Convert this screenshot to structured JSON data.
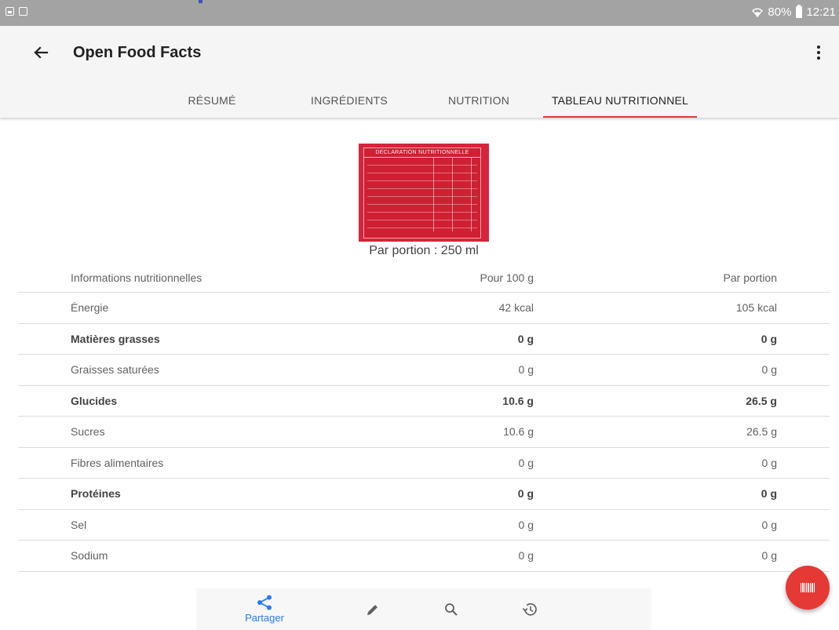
{
  "status_bar": {
    "battery": "80%",
    "time": "12:21",
    "left_icons": [
      "image-icon",
      "mms-icon"
    ],
    "right_icons": [
      "wifi-icon",
      "battery-icon"
    ]
  },
  "app_bar": {
    "title": "Open Food Facts",
    "back_icon": "arrow-left-icon",
    "menu_icon": "more-vertical-icon"
  },
  "tabs": [
    {
      "label": "RÉSUMÉ",
      "active": false
    },
    {
      "label": "INGRÉDIENTS",
      "active": false
    },
    {
      "label": "NUTRITION",
      "active": false
    },
    {
      "label": "TABLEAU NUTRITIONNEL",
      "active": true
    }
  ],
  "nutrition_image": {
    "label_heading": "DECLARATION NUTRITIONNELLE"
  },
  "portion": "Par portion : 250 ml",
  "table": {
    "headers": [
      "Informations nutritionnelles",
      "Pour 100 g",
      "Par portion"
    ],
    "rows": [
      {
        "name": "Énergie",
        "per100": "42 kcal",
        "portion": "105 kcal",
        "bold": false
      },
      {
        "name": "Matières grasses",
        "per100": "0 g",
        "portion": "0 g",
        "bold": true
      },
      {
        "name": "Graisses saturées",
        "per100": "0 g",
        "portion": "0 g",
        "bold": false
      },
      {
        "name": "Glucides",
        "per100": "10.6 g",
        "portion": "26.5 g",
        "bold": true
      },
      {
        "name": "Sucres",
        "per100": "10.6 g",
        "portion": "26.5 g",
        "bold": false
      },
      {
        "name": "Fibres alimentaires",
        "per100": "0 g",
        "portion": "0 g",
        "bold": false
      },
      {
        "name": "Protéines",
        "per100": "0 g",
        "portion": "0 g",
        "bold": true
      },
      {
        "name": "Sel",
        "per100": "0 g",
        "portion": "0 g",
        "bold": false
      },
      {
        "name": "Sodium",
        "per100": "0 g",
        "portion": "0 g",
        "bold": false
      }
    ]
  },
  "bottom_nav": {
    "share_label": "Partager",
    "items": [
      "share-icon",
      "edit-icon",
      "search-icon",
      "history-icon"
    ]
  },
  "fab": {
    "icon": "barcode-icon"
  },
  "colors": {
    "accent": "#e53935",
    "nav_active": "#2979ff",
    "status_bar": "#a3a3a3",
    "app_bar": "#f5f5f5"
  }
}
